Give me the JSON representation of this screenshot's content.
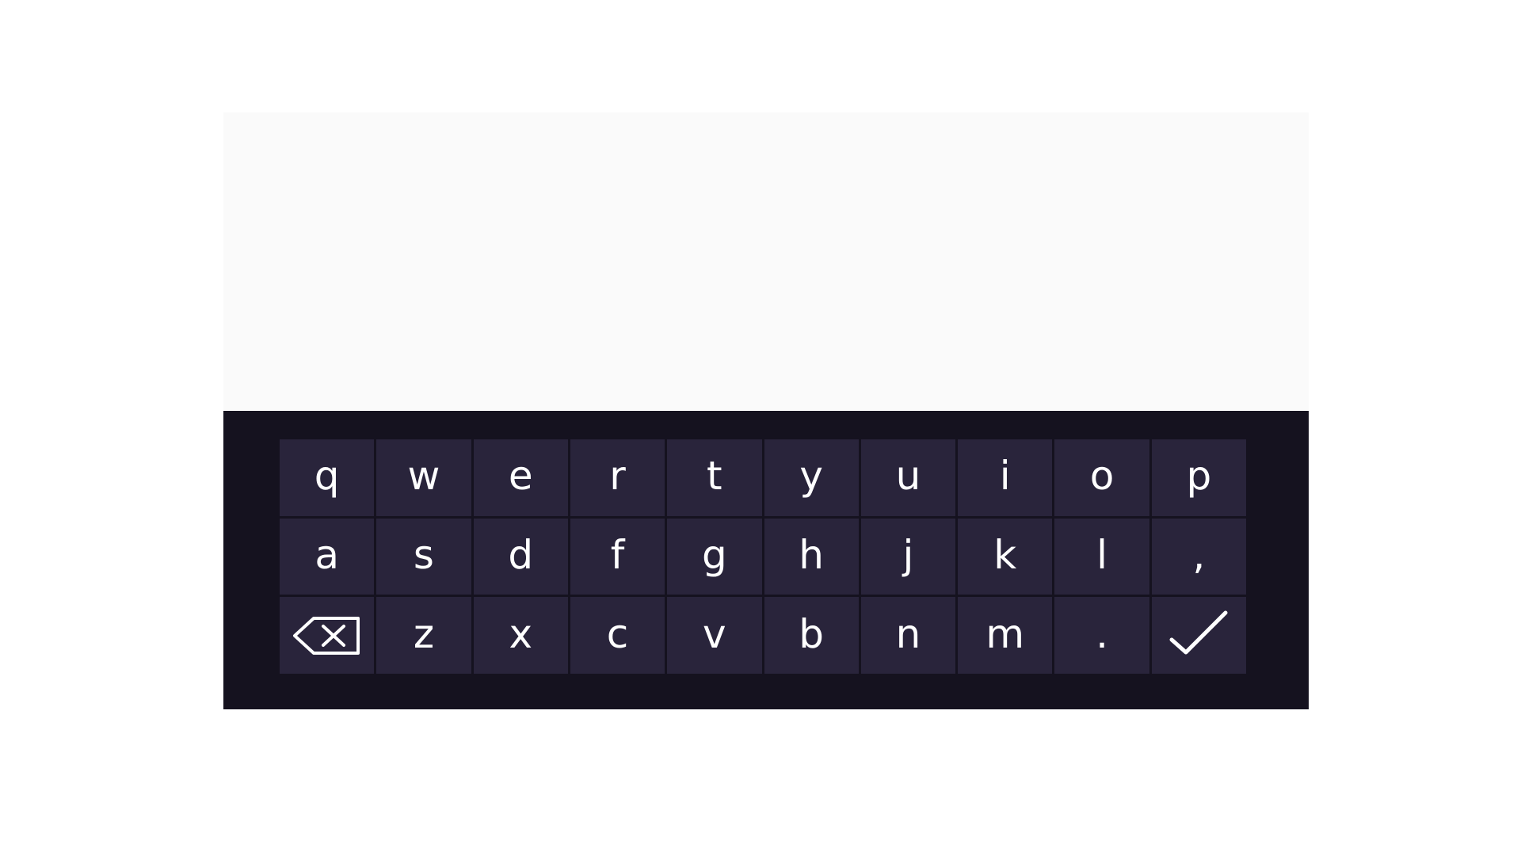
{
  "text_input": {
    "value": ""
  },
  "keyboard": {
    "rows": [
      [
        "q",
        "w",
        "e",
        "r",
        "t",
        "y",
        "u",
        "i",
        "o",
        "p"
      ],
      [
        "a",
        "s",
        "d",
        "f",
        "g",
        "h",
        "j",
        "k",
        "l",
        ","
      ],
      [
        "z",
        "x",
        "c",
        "v",
        "b",
        "n",
        "m",
        "."
      ]
    ],
    "backspace_icon": "backspace-icon",
    "enter_icon": "checkmark-icon"
  },
  "colors": {
    "text_area_bg": "#fafafa",
    "keyboard_bg": "#15121f",
    "key_bg": "#29243b",
    "key_text": "#ffffff"
  }
}
